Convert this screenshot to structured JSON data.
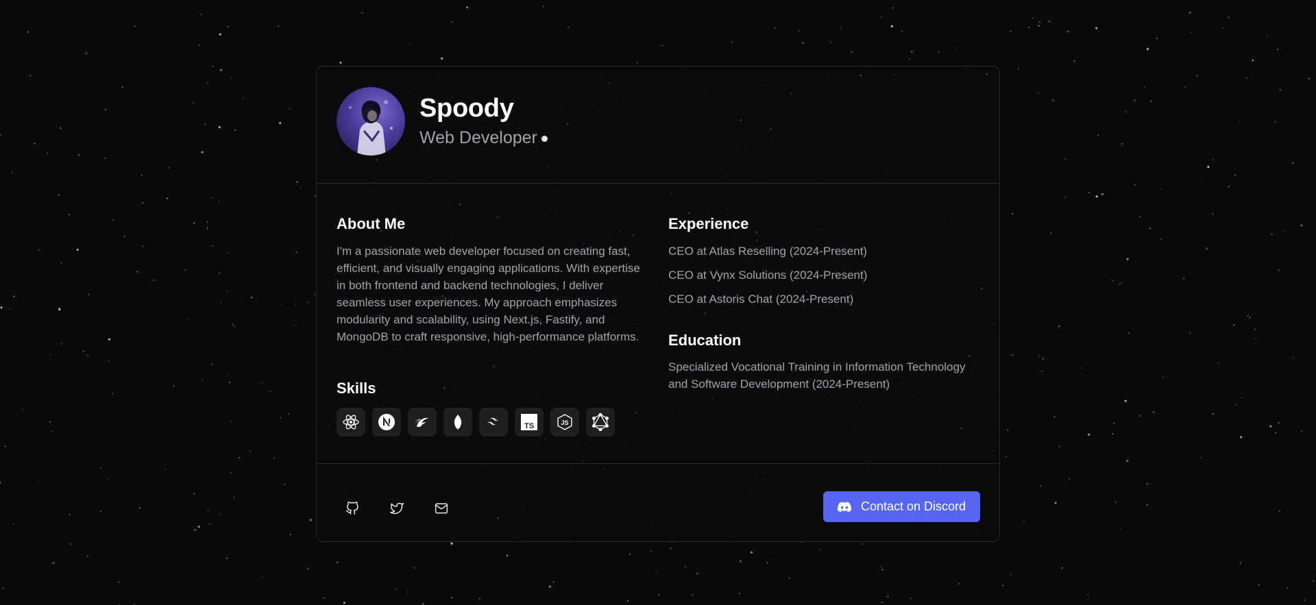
{
  "profile": {
    "name": "Spoody",
    "role": "Web Developer"
  },
  "about": {
    "heading": "About Me",
    "text": "I'm a passionate web developer focused on creating fast, efficient, and visually engaging applications. With expertise in both frontend and backend technologies, I deliver seamless user experiences. My approach emphasizes modularity and scalability, using Next.js, Fastify, and MongoDB to craft responsive, high-performance platforms."
  },
  "skills": {
    "heading": "Skills",
    "icons": [
      "react-icon",
      "nextjs-icon",
      "prisma-icon",
      "mongodb-icon",
      "tailwind-icon",
      "typescript-icon",
      "nodejs-icon",
      "graphql-icon"
    ]
  },
  "experience": {
    "heading": "Experience",
    "items": [
      "CEO at Atlas Reselling (2024-Present)",
      "CEO at Vynx Solutions (2024-Present)",
      "CEO at Astoris Chat (2024-Present)"
    ]
  },
  "education": {
    "heading": "Education",
    "text": "Specialized Vocational Training in Information Technology and Software Development (2024-Present)"
  },
  "footer": {
    "social": [
      "github-icon",
      "twitter-icon",
      "mail-icon"
    ],
    "contact_label": "Contact on Discord"
  },
  "colors": {
    "background": "#0a0a0c",
    "card_border": "#2a2a2e",
    "accent": "#5865f2",
    "muted_text": "#a3a3a8"
  }
}
